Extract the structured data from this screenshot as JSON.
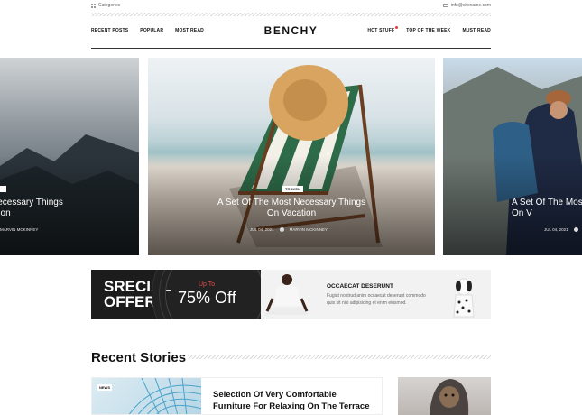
{
  "topbar": {
    "categories": "Categories",
    "email": "info@sitename.com"
  },
  "nav": {
    "logo": "BENCHY",
    "left": [
      "RECENT POSTS",
      "POPULAR",
      "MOST READ"
    ],
    "right": [
      "HOT STUFF",
      "TOP OF THE WEEK",
      "MUST READ"
    ]
  },
  "slider": [
    {
      "title": "Necessary Things\nation",
      "author": "MARVIN MCKINNEY"
    },
    {
      "tag": "TRAVEL",
      "title": "A Set Of The Most Necessary Things\nOn Vacation",
      "date": "JUL 04, 2021",
      "author": "MARVIN MCKINNEY"
    },
    {
      "title": "A Set Of The Mos\nOn V",
      "date": "JUL 04, 2021"
    }
  ],
  "banner": {
    "line1": "SRECIAL",
    "line2": "OFFER",
    "upto": "Up To",
    "percent": "75% Off",
    "heading": "OCCAECAT DESERUNT",
    "text": "Fugiat nostrud anim occaecat deserunt commodo quis sit nisi adipisicing et enim eiusmod."
  },
  "section": {
    "title": "Recent Stories"
  },
  "story": {
    "tag": "NEWS",
    "title": "Selection Of Very Comfortable Furniture For Relaxing On The Terrace"
  },
  "colors": {
    "accent": "#e14b4b",
    "dark": "#222222"
  }
}
